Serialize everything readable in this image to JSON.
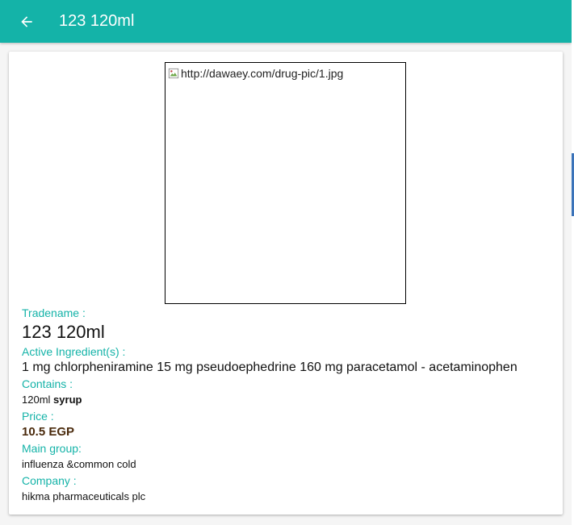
{
  "header": {
    "title": "123 120ml",
    "back_icon": "arrow-back-icon",
    "background_color": "#14b3a8"
  },
  "drug": {
    "image_alt": "http://dawaey.com/drug-pic/1.jpg",
    "tradename_label": "Tradename :",
    "tradename": "123 120ml",
    "active_label": "Active Ingredient(s) :",
    "active": "1 mg chlorpheniramine 15 mg pseudoephedrine 160 mg paracetamol - acetaminophen",
    "contains_label": "Contains :",
    "contains_amount": "120ml",
    "contains_form": "syrup",
    "price_label": "Price :",
    "price": "10.5 EGP",
    "group_label": "Main group:",
    "group": "influenza &common cold",
    "company_label": "Company :",
    "company": "hikma pharmaceuticals plc"
  },
  "colors": {
    "accent": "#14b3a8",
    "price": "#4a2a0c"
  }
}
